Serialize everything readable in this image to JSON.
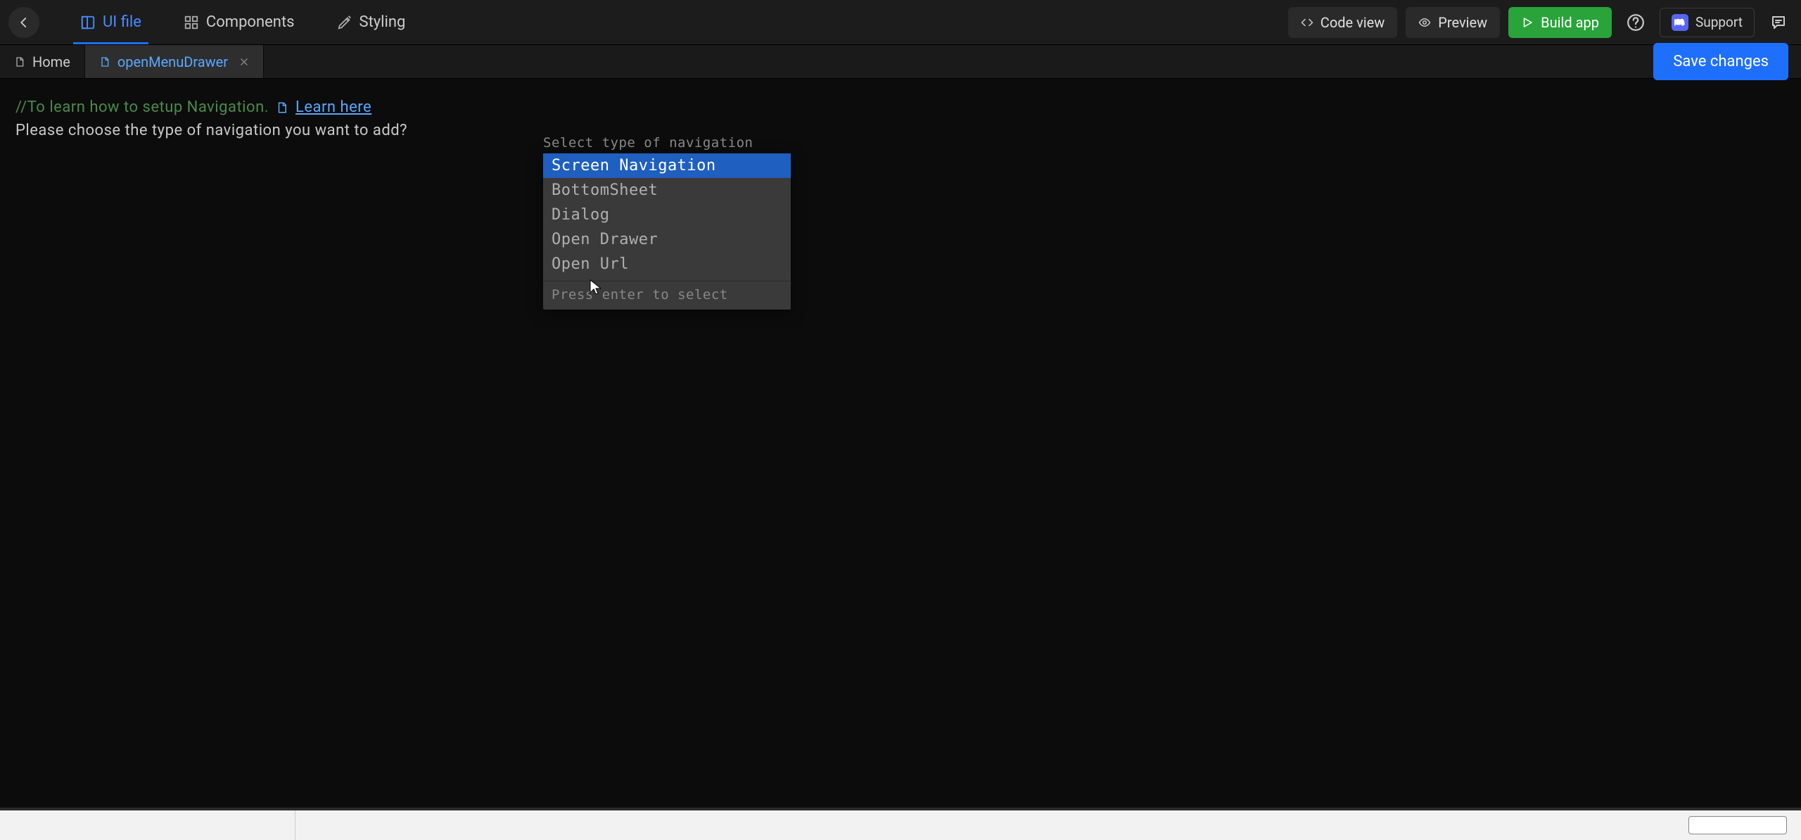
{
  "toolbar": {
    "tabs": [
      {
        "label": "UI file",
        "icon": "ui-file-icon",
        "active": true
      },
      {
        "label": "Components",
        "icon": "components-icon",
        "active": false
      },
      {
        "label": "Styling",
        "icon": "styling-icon",
        "active": false
      }
    ],
    "code_view": "Code view",
    "preview": "Preview",
    "build": "Build app",
    "support": "Support"
  },
  "filetabs": {
    "home": "Home",
    "active": "openMenuDrawer",
    "save": "Save changes"
  },
  "editor": {
    "comment": "//To learn how to setup Navigation.",
    "learn": "Learn here",
    "prompt": "Please choose the type of navigation you want to add?"
  },
  "dropdown": {
    "label": "Select type of navigation",
    "items": [
      "Screen Navigation",
      "BottomSheet",
      "Dialog",
      "Open Drawer",
      "Open Url"
    ],
    "selected_index": 0,
    "hint": "Press enter to select"
  }
}
